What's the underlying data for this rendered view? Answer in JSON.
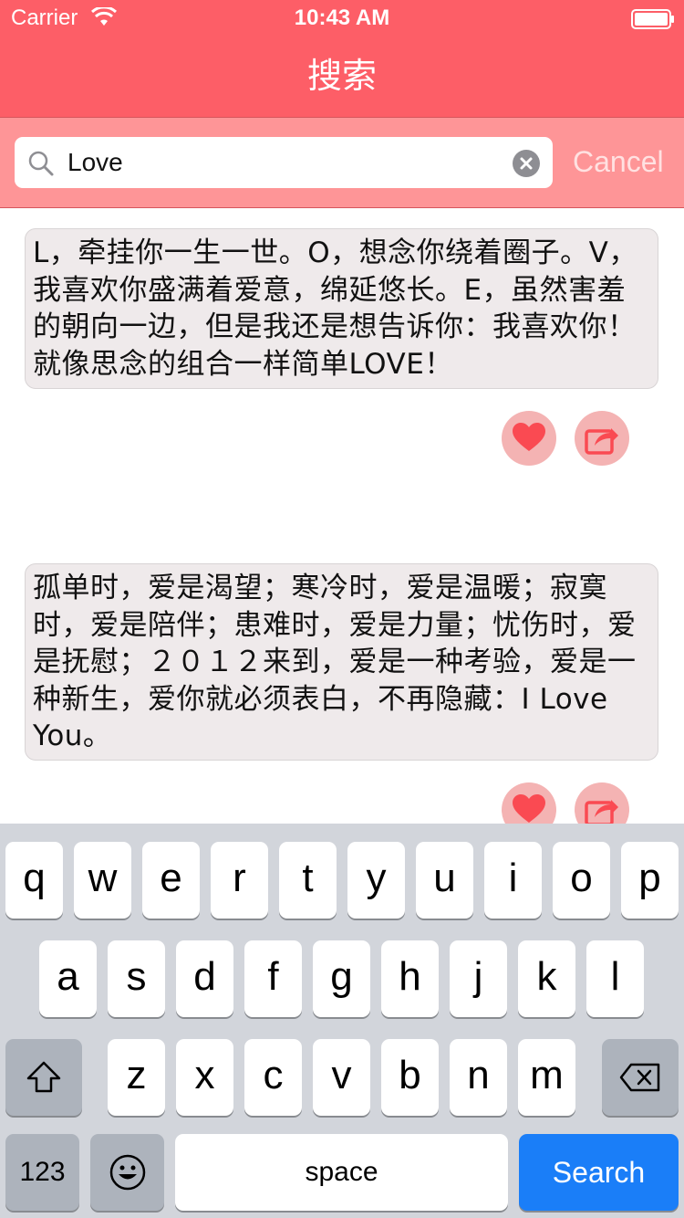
{
  "status_bar": {
    "carrier": "Carrier",
    "time": "10:43 AM"
  },
  "nav": {
    "title": "搜索"
  },
  "search": {
    "value": "Love",
    "cancel_label": "Cancel"
  },
  "results": [
    {
      "text": "L，牵挂你一生一世。O，想念你绕着圈子。V，我喜欢你盛满着爱意，绵延悠长。E，虽然害羞的朝向一边，但是我还是想告诉你：我喜欢你！就像思念的组合一样简单LOVE！"
    },
    {
      "text": "孤单时，爱是渴望；寒冷时，爱是温暖；寂寞时，爱是陪伴；患难时，爱是力量；忧伤时，爱是抚慰；２０１２来到，爱是一种考验，爱是一种新生，爱你就必须表白，不再隐藏：I Love You。"
    }
  ],
  "keyboard": {
    "row1": [
      "q",
      "w",
      "e",
      "r",
      "t",
      "y",
      "u",
      "i",
      "o",
      "p"
    ],
    "row2": [
      "a",
      "s",
      "d",
      "f",
      "g",
      "h",
      "j",
      "k",
      "l"
    ],
    "row3": [
      "z",
      "x",
      "c",
      "v",
      "b",
      "n",
      "m"
    ],
    "numbers_label": "123",
    "space_label": "space",
    "search_label": "Search"
  },
  "colors": {
    "nav_bg": "#fd5e67",
    "search_bg": "#fe9597",
    "accent_heart": "#fa4a52",
    "search_key": "#1a7ef8"
  }
}
